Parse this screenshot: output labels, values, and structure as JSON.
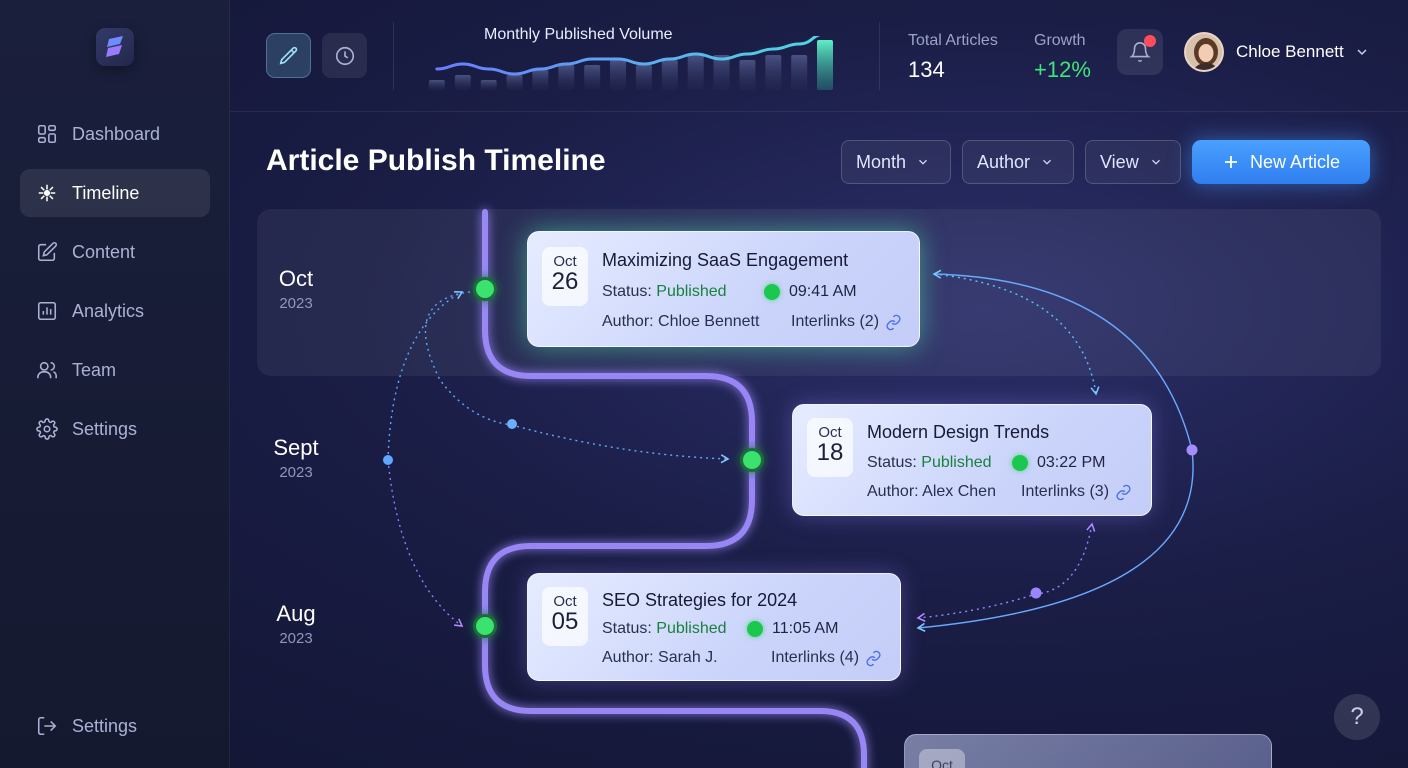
{
  "sidebar": {
    "items": [
      {
        "label": "Dashboard",
        "icon": "dashboard-icon"
      },
      {
        "label": "Timeline",
        "icon": "timeline-icon",
        "active": true
      },
      {
        "label": "Content",
        "icon": "edit-icon"
      },
      {
        "label": "Analytics",
        "icon": "analytics-icon"
      },
      {
        "label": "Team",
        "icon": "team-icon"
      },
      {
        "label": "Settings",
        "icon": "gear-icon"
      }
    ],
    "footer_label": "Settings"
  },
  "topbar": {
    "chart_title": "Monthly Published Volume",
    "stats": [
      {
        "label": "Total Articles",
        "value": "134"
      },
      {
        "label": "Growth",
        "value": "+12%"
      }
    ],
    "user_name": "Chloe Bennett"
  },
  "chart_data": {
    "type": "bar",
    "title": "Monthly Published Volume",
    "values": [
      2,
      3,
      2,
      3,
      4,
      5,
      5,
      6,
      5,
      6,
      7,
      7,
      6,
      7,
      7,
      10
    ],
    "line": [
      3,
      4,
      3,
      2,
      3,
      4,
      5,
      5,
      4,
      5,
      6,
      5,
      6,
      7,
      8,
      10
    ],
    "ylim": [
      0,
      10
    ]
  },
  "header": {
    "title": "Article Publish Timeline",
    "filters": [
      "Month",
      "Author",
      "View"
    ],
    "new_button": "New Article"
  },
  "months": [
    {
      "month": "Oct",
      "year": "2023"
    },
    {
      "month": "Sept",
      "year": "2023"
    },
    {
      "month": "Aug",
      "year": "2023"
    }
  ],
  "articles": [
    {
      "date_month": "Oct",
      "date_day": "26",
      "title": "Maximizing SaaS Engagement",
      "status_label": "Status:",
      "status": "Published",
      "time": "09:41 AM",
      "author": "Author: Chloe Bennett",
      "interlinks": "Interlinks (2)"
    },
    {
      "date_month": "Oct",
      "date_day": "18",
      "title": "Modern Design Trends",
      "status_label": "Status:",
      "status": "Published",
      "time": "03:22 PM",
      "author": "Author: Alex Chen",
      "interlinks": "Interlinks (3)"
    },
    {
      "date_month": "Oct",
      "date_day": "05",
      "title": "SEO Strategies for 2024",
      "status_label": "Status:",
      "status": "Published",
      "time": "11:05 AM",
      "author": "Author: Sarah J.",
      "interlinks": "Interlinks (4)"
    }
  ],
  "ghost_card": {
    "date_month": "Oct"
  },
  "help_label": "?"
}
